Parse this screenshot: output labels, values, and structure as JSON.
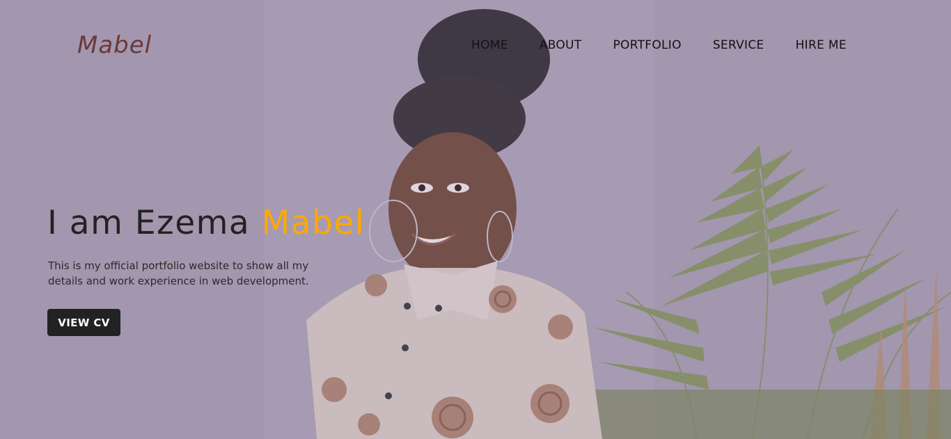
{
  "brand": {
    "logo": "Mabel",
    "logo_color": "#6b3838"
  },
  "nav": {
    "home": "HOME",
    "about": "ABOUT",
    "portfolio": "PORTFOLIO",
    "service": "SERVICE",
    "hire": "HIRE ME"
  },
  "hero": {
    "headline_prefix": "I am Ezema ",
    "headline_accent": "Mabel",
    "accent_color": "#ffa800",
    "description": "This is my official portfolio website to show all my details and work experience in web development.",
    "cta_label": "VIEW CV",
    "background_color": "#a59aae"
  }
}
